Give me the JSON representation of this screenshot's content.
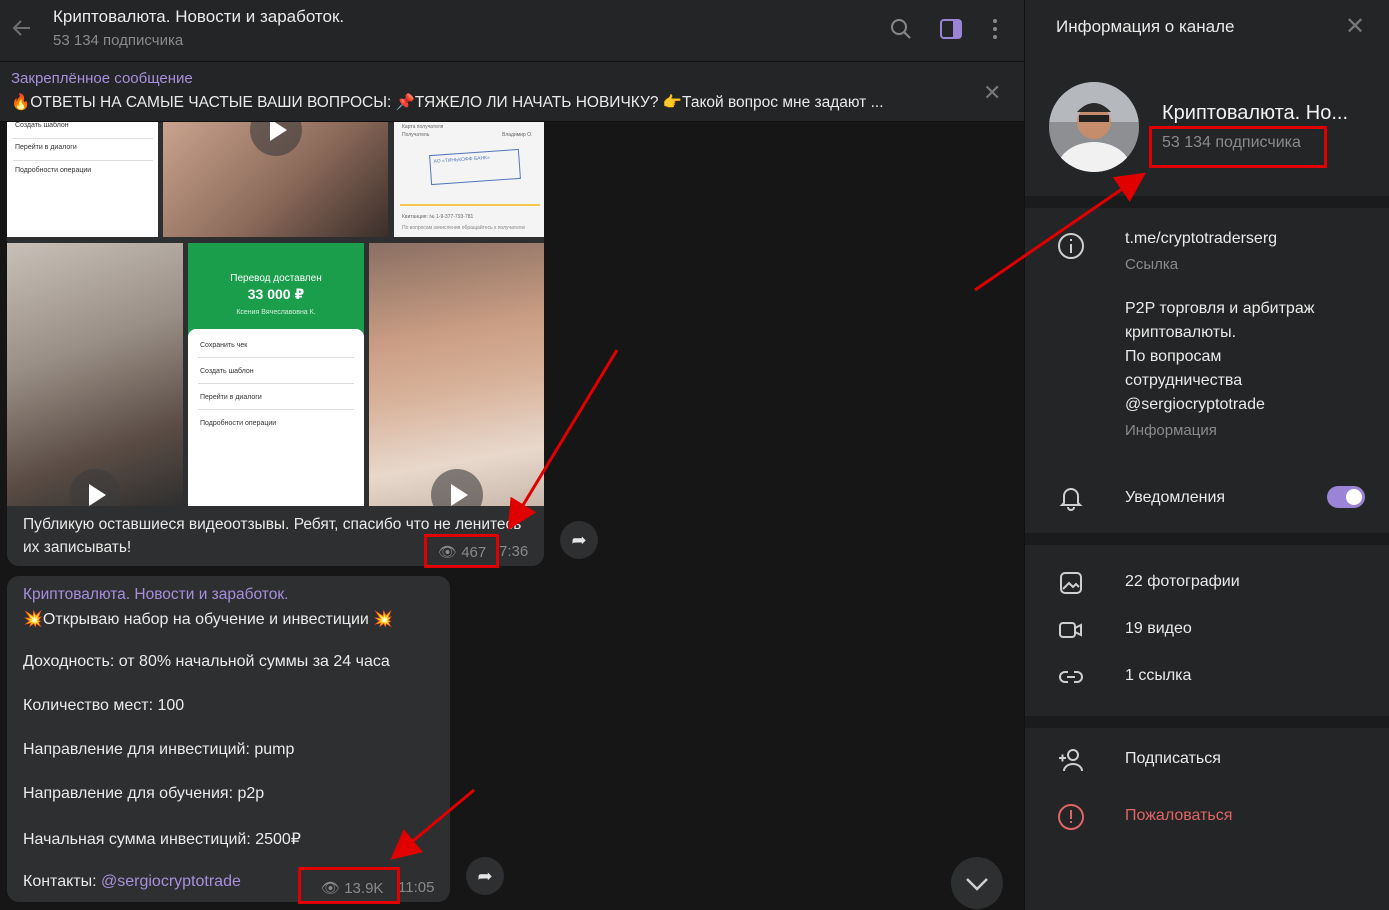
{
  "header": {
    "title": "Криптовалюта. Новости и заработок.",
    "subtitle": "53 134 подписчика",
    "icons": [
      "back-arrow-icon",
      "search-icon",
      "sidebar-toggle-icon",
      "more-vertical-icon"
    ]
  },
  "pinned": {
    "label": "Закреплённое сообщение",
    "text": "🔥ОТВЕТЫ НА САМЫЕ ЧАСТЫЕ ВАШИ ВОПРОСЫ: 📌ТЯЖЕЛО ЛИ НАЧАТЬ НОВИЧКУ? 👉Такой вопрос мне задают ..."
  },
  "media_message": {
    "receipt_small": {
      "items": [
        "Создать шаблон",
        "Перейти в диалоги",
        "Подробности операции"
      ]
    },
    "receipt_big": {
      "title": "Перевод доставлен",
      "amount": "33 000 ₽",
      "name": "Ксения Вячеславовна К.",
      "items": [
        "Сохранить чек",
        "Создать шаблон",
        "Перейти в диалоги",
        "Подробности операции"
      ]
    },
    "document": {
      "l1": "Карта получателя",
      "l2": "Получатель",
      "r2": "Владимир О.",
      "stamp": "АО «ТИНЬКОФФ БАНК»",
      "receipt_no": "Квитанция: № 1-9-377-793-781",
      "footer": "По вопросам зачисления обращайтесь к получателю"
    },
    "caption": "Публикую оставшиеся видеоотзывы. Ребят, спасибо что не ленитесь их записывать!",
    "views": "467",
    "time": "7:36"
  },
  "text_message": {
    "author": "Криптовалюта. Новости и заработок.",
    "line1": "💥Открываю набор на обучение и инвестиции 💥",
    "line2": "Доходность: от 80%  начальной суммы за 24 часа",
    "line3": "Количество мест: 100",
    "line4": "Направление для инвестиций: pump",
    "line5": "Направление для обучения: p2p",
    "line6": "Начальная сумма инвестиций: 2500₽",
    "contacts_label": "Контакты: ",
    "contacts_link": "@sergiocryptotrade",
    "views": "13.9K",
    "time": "11:05"
  },
  "side": {
    "title": "Информация о канале",
    "channel_name": "Криптовалюта. Но...",
    "subscribers": "53 134 подписчика",
    "link": "t.me/cryptotraderserg",
    "link_caption": "Ссылка",
    "bio1": "P2P торговля и арбитраж",
    "bio2": "криптовалюты.",
    "bio3": "По вопросам",
    "bio4": "сотрудничества",
    "bio_link": "@sergiocryptotrade",
    "bio_caption": "Информация",
    "notifications": "Уведомления",
    "notifications_on": true,
    "photos": "22 фотографии",
    "videos": "19 видео",
    "links": "1 ссылка",
    "subscribe": "Подписаться",
    "report": "Пожаловаться"
  },
  "colors": {
    "accent": "#a88fde",
    "annotation_red": "#e10000",
    "danger": "#e06464"
  }
}
